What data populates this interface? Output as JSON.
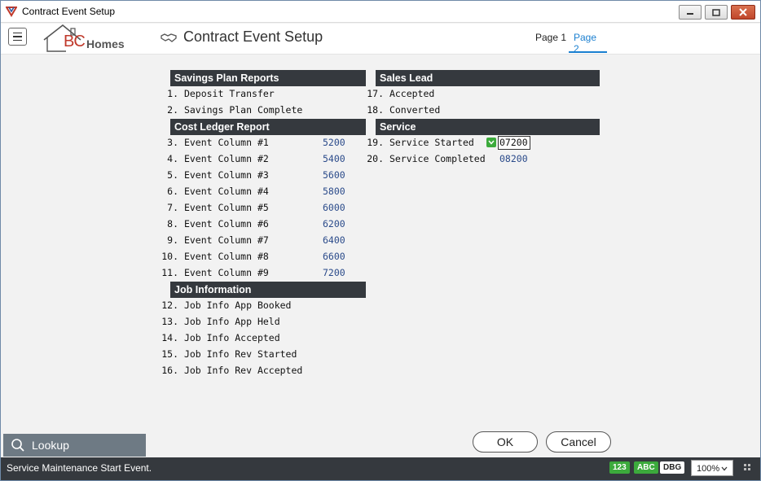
{
  "window": {
    "title": "Contract Event Setup"
  },
  "header": {
    "logo_letters": "BC",
    "logo_word": "Homes",
    "page_title": "Contract Event Setup",
    "tabs": [
      {
        "label": "Page 1"
      },
      {
        "label": "Page 2",
        "active": true
      }
    ]
  },
  "sections": {
    "savings": "Savings Plan Reports",
    "cost": "Cost Ledger Report",
    "job": "Job Information",
    "sales": "Sales Lead",
    "service": "Service"
  },
  "items": [
    {
      "num": "1.",
      "label": "Deposit Transfer",
      "value": ""
    },
    {
      "num": "2.",
      "label": "Savings Plan Complete",
      "value": ""
    },
    {
      "num": "3.",
      "label": "Event Column #1",
      "value": "5200"
    },
    {
      "num": "4.",
      "label": "Event Column #2",
      "value": "5400"
    },
    {
      "num": "5.",
      "label": "Event Column #3",
      "value": "5600"
    },
    {
      "num": "6.",
      "label": "Event Column #4",
      "value": "5800"
    },
    {
      "num": "7.",
      "label": "Event Column #5",
      "value": "6000"
    },
    {
      "num": "8.",
      "label": "Event Column #6",
      "value": "6200"
    },
    {
      "num": "9.",
      "label": "Event Column #7",
      "value": "6400"
    },
    {
      "num": "10.",
      "label": "Event Column #8",
      "value": "6600"
    },
    {
      "num": "11.",
      "label": "Event Column #9",
      "value": "7200"
    },
    {
      "num": "12.",
      "label": "Job Info App Booked",
      "value": ""
    },
    {
      "num": "13.",
      "label": "Job Info App Held",
      "value": ""
    },
    {
      "num": "14.",
      "label": "Job Info Accepted",
      "value": ""
    },
    {
      "num": "15.",
      "label": "Job Info Rev Started",
      "value": ""
    },
    {
      "num": "16.",
      "label": "Job Info Rev Accepted",
      "value": ""
    },
    {
      "num": "17.",
      "label": "Accepted",
      "value": ""
    },
    {
      "num": "18.",
      "label": "Converted",
      "value": ""
    },
    {
      "num": "19.",
      "label": "Service Started",
      "value": "07200"
    },
    {
      "num": "20.",
      "label": "Service Completed",
      "value": "08200"
    }
  ],
  "lookup": {
    "label": "Lookup"
  },
  "buttons": {
    "ok": "OK",
    "cancel": "Cancel"
  },
  "status": {
    "text": "Service Maintenance Start Event.",
    "badges": [
      "123",
      "ABC",
      "DBG"
    ],
    "zoom": "100%"
  },
  "colors": {
    "accent": "#1a7fd0",
    "section_bg": "#35393e",
    "value_text": "#2a4a8a",
    "badge_green": "#3caa3c"
  }
}
